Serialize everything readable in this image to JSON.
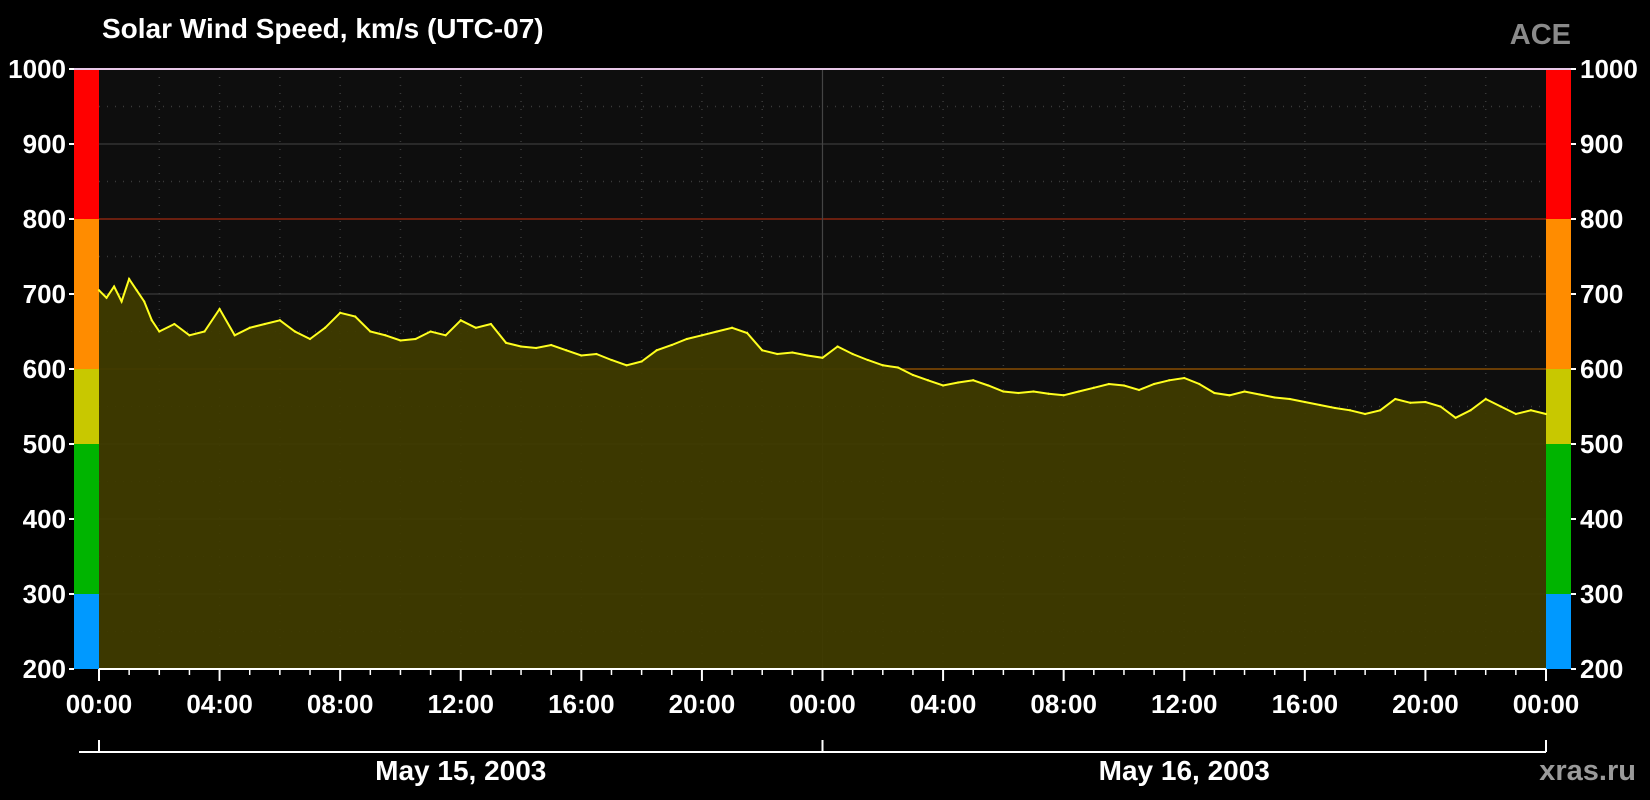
{
  "title": "Solar Wind Speed, km/s (UTC-07)",
  "source_label": "ACE",
  "credit": "xras.ru",
  "colors": {
    "background": "#000000",
    "plot_bg": "#0e0e0e",
    "line": "#ffff1e",
    "fill": "#3f3b00",
    "band_blue": "#0099ff",
    "band_green": "#00b400",
    "band_yellow": "#c8c800",
    "band_orange": "#ff8c00",
    "band_red": "#ff0000"
  },
  "chart_data": {
    "type": "area",
    "title": "Solar Wind Speed, km/s (UTC-07)",
    "xlabel": "",
    "ylabel": "",
    "ylim": [
      200,
      1000
    ],
    "xlim_hours": [
      0,
      48
    ],
    "yticks": [
      200,
      300,
      400,
      500,
      600,
      700,
      800,
      900,
      1000
    ],
    "xtick_labels": [
      "00:00",
      "04:00",
      "08:00",
      "12:00",
      "16:00",
      "20:00",
      "00:00",
      "04:00",
      "08:00",
      "12:00",
      "16:00",
      "20:00",
      "00:00"
    ],
    "date_labels": [
      "May 15, 2003",
      "May 16, 2003"
    ],
    "grid": true,
    "threshold_lines": [
      600,
      800
    ],
    "color_bands": [
      {
        "from": 200,
        "to": 300,
        "color": "#0099ff"
      },
      {
        "from": 300,
        "to": 500,
        "color": "#00b400"
      },
      {
        "from": 500,
        "to": 600,
        "color": "#c8c800"
      },
      {
        "from": 600,
        "to": 800,
        "color": "#ff8c00"
      },
      {
        "from": 800,
        "to": 1000,
        "color": "#ff0000"
      }
    ],
    "series": [
      {
        "x_hours": [
          0,
          0.25,
          0.5,
          0.75,
          1.0,
          1.25,
          1.5,
          1.75,
          2.0,
          2.5,
          3.0,
          3.5,
          4.0,
          4.5,
          5.0,
          5.5,
          6.0,
          6.5,
          7.0,
          7.5,
          8.0,
          8.5,
          9.0,
          9.5,
          10.0,
          10.5,
          11.0,
          11.5,
          12.0,
          12.5,
          13.0,
          13.5,
          14.0,
          14.5,
          15.0,
          15.5,
          16.0,
          16.5,
          17.0,
          17.5,
          18.0,
          18.5,
          19.0,
          19.5,
          20.0,
          20.5,
          21.0,
          21.5,
          22.0,
          22.5,
          23.0,
          23.5,
          24.0,
          24.5,
          25.0,
          25.5,
          26.0,
          26.5,
          27.0,
          27.5,
          28.0,
          28.5,
          29.0,
          29.5,
          30.0,
          30.5,
          31.0,
          31.5,
          32.0,
          32.5,
          33.0,
          33.5,
          34.0,
          34.5,
          35.0,
          35.5,
          36.0,
          36.5,
          37.0,
          37.5,
          38.0,
          38.5,
          39.0,
          39.5,
          40.0,
          40.5,
          41.0,
          41.5,
          42.0,
          42.5,
          43.0,
          43.5,
          44.0,
          44.5,
          45.0,
          45.5,
          46.0,
          46.5,
          47.0,
          47.5,
          48.0
        ],
        "values": [
          705,
          695,
          710,
          690,
          720,
          705,
          690,
          665,
          650,
          660,
          645,
          650,
          680,
          645,
          655,
          660,
          665,
          650,
          640,
          655,
          675,
          670,
          650,
          645,
          638,
          640,
          650,
          645,
          665,
          655,
          660,
          635,
          630,
          628,
          632,
          625,
          618,
          620,
          612,
          605,
          610,
          625,
          632,
          640,
          645,
          650,
          655,
          648,
          625,
          620,
          622,
          618,
          615,
          630,
          620,
          612,
          605,
          602,
          592,
          585,
          578,
          582,
          585,
          578,
          570,
          568,
          570,
          567,
          565,
          570,
          575,
          580,
          578,
          572,
          580,
          585,
          588,
          580,
          568,
          565,
          570,
          566,
          562,
          560,
          556,
          552,
          548,
          545,
          540,
          545,
          560,
          555,
          556,
          550,
          535,
          545,
          560,
          550,
          540,
          545,
          540
        ]
      }
    ]
  }
}
